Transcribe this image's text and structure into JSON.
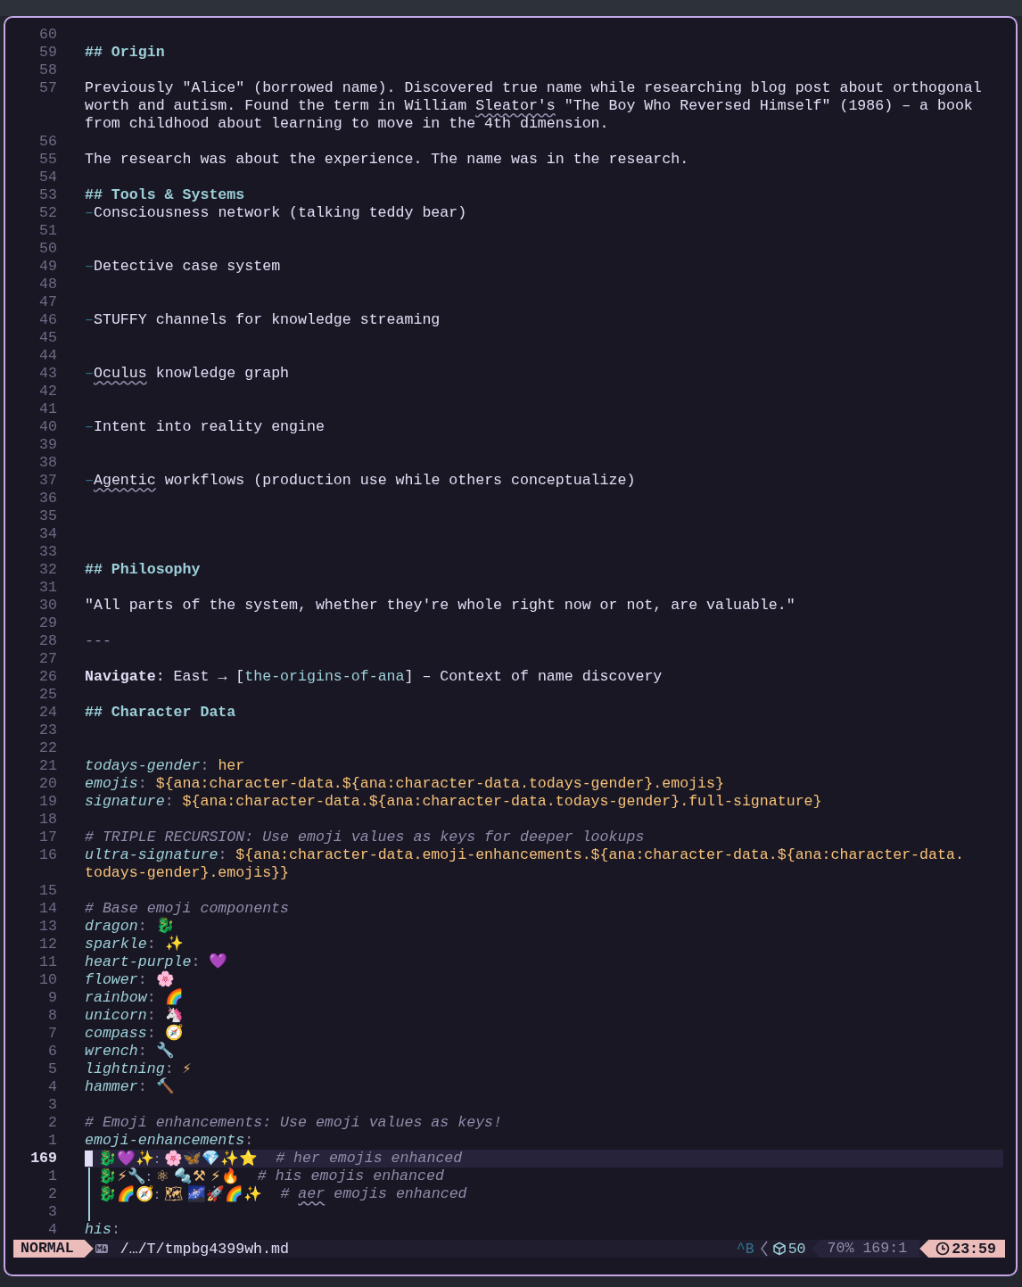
{
  "lines": [
    {
      "number": "60",
      "kind": "blank",
      "current": false
    },
    {
      "number": "59",
      "kind": "heading",
      "current": false,
      "text": "## Origin"
    },
    {
      "number": "58",
      "kind": "blank",
      "current": false
    },
    {
      "number": "57",
      "kind": "prose",
      "current": false,
      "segments": [
        {
          "text": "Previously \"Alice\" (borrowed name). Discovered true name while researching blog post about orthogonal",
          "misspelled": false
        }
      ]
    },
    {
      "kind": "prose",
      "current": false,
      "segments": [
        {
          "text": "worth and autism. Found the term in William ",
          "misspelled": false
        },
        {
          "text": "Sleator's",
          "misspelled": true
        },
        {
          "text": " \"The Boy Who Reversed Himself\" (1986) – a book",
          "misspelled": false
        }
      ]
    },
    {
      "kind": "prose",
      "current": false,
      "segments": [
        {
          "text": "from childhood about learning to move in the 4th dimension.",
          "misspelled": false
        }
      ]
    },
    {
      "number": "56",
      "kind": "blank",
      "current": false
    },
    {
      "number": "55",
      "kind": "prose",
      "current": false,
      "segments": [
        {
          "text": "The research was about the experience. The name was in the research.",
          "misspelled": false
        }
      ]
    },
    {
      "number": "54",
      "kind": "blank",
      "current": false
    },
    {
      "number": "53",
      "kind": "heading",
      "current": false,
      "text": "## Tools & Systems"
    },
    {
      "number": "52",
      "kind": "bullet",
      "current": false,
      "marker": "–",
      "segments": [
        {
          "text": "Consciousness network (talking teddy bear)",
          "misspelled": false
        }
      ]
    },
    {
      "number": "51",
      "kind": "blank",
      "current": false
    },
    {
      "number": "50",
      "kind": "blank",
      "current": false
    },
    {
      "number": "49",
      "kind": "bullet",
      "current": false,
      "marker": "–",
      "segments": [
        {
          "text": "Detective case system",
          "misspelled": false
        }
      ]
    },
    {
      "number": "48",
      "kind": "blank",
      "current": false
    },
    {
      "number": "47",
      "kind": "blank",
      "current": false
    },
    {
      "number": "46",
      "kind": "bullet",
      "current": false,
      "marker": "–",
      "segments": [
        {
          "text": "STUFFY channels for knowledge streaming",
          "misspelled": false
        }
      ]
    },
    {
      "number": "45",
      "kind": "blank",
      "current": false
    },
    {
      "number": "44",
      "kind": "blank",
      "current": false
    },
    {
      "number": "43",
      "kind": "bullet",
      "current": false,
      "marker": "–",
      "segments": [
        {
          "text": "Oculus",
          "misspelled": true
        },
        {
          "text": " knowledge graph",
          "misspelled": false
        }
      ]
    },
    {
      "number": "42",
      "kind": "blank",
      "current": false
    },
    {
      "number": "41",
      "kind": "blank",
      "current": false
    },
    {
      "number": "40",
      "kind": "bullet",
      "current": false,
      "marker": "–",
      "segments": [
        {
          "text": "Intent into reality engine",
          "misspelled": false
        }
      ]
    },
    {
      "number": "39",
      "kind": "blank",
      "current": false
    },
    {
      "number": "38",
      "kind": "blank",
      "current": false
    },
    {
      "number": "37",
      "kind": "bullet",
      "current": false,
      "marker": "–",
      "segments": [
        {
          "text": "Agentic",
          "misspelled": true
        },
        {
          "text": " workflows (production use while others conceptualize)",
          "misspelled": false
        }
      ]
    },
    {
      "number": "36",
      "kind": "blank",
      "current": false
    },
    {
      "number": "35",
      "kind": "blank",
      "current": false
    },
    {
      "number": "34",
      "kind": "blank",
      "current": false
    },
    {
      "number": "33",
      "kind": "blank",
      "current": false
    },
    {
      "number": "32",
      "kind": "heading",
      "current": false,
      "text": "## Philosophy"
    },
    {
      "number": "31",
      "kind": "blank",
      "current": false
    },
    {
      "number": "30",
      "kind": "prose",
      "current": false,
      "segments": [
        {
          "text": "\"All parts of the system, whether they're whole right now or not, are valuable.\"",
          "misspelled": false
        }
      ]
    },
    {
      "number": "29",
      "kind": "blank",
      "current": false
    },
    {
      "number": "28",
      "kind": "rule",
      "current": false,
      "text": "---"
    },
    {
      "number": "27",
      "kind": "blank",
      "current": false
    },
    {
      "number": "26",
      "kind": "nav",
      "current": false,
      "before": "**Navigate**: East → [",
      "link": "the-origins-of-ana",
      "after": "] – Context of name discovery"
    },
    {
      "number": "25",
      "kind": "blank",
      "current": false
    },
    {
      "number": "24",
      "kind": "heading",
      "current": false,
      "text": "## Character Data"
    },
    {
      "number": "23",
      "kind": "blank",
      "current": false
    },
    {
      "number": "22",
      "kind": "blank",
      "current": false
    },
    {
      "number": "21",
      "kind": "pair",
      "current": false,
      "key": "todays-gender",
      "separator": ":",
      "value": "her"
    },
    {
      "number": "20",
      "kind": "pair",
      "current": false,
      "key": "emojis",
      "separator": ":",
      "value": "${ana:character-data.${ana:character-data.todays-gender}.emojis}"
    },
    {
      "number": "19",
      "kind": "pair",
      "current": false,
      "key": "signature",
      "separator": ":",
      "value": "${ana:character-data.${ana:character-data.todays-gender}.full-signature}"
    },
    {
      "number": "18",
      "kind": "blank",
      "current": false
    },
    {
      "number": "17",
      "kind": "comment",
      "current": false,
      "segments": [
        {
          "text": "# TRIPLE RECURSION: Use emoji values as keys for deeper lookups",
          "misspelled": false
        }
      ]
    },
    {
      "number": "16",
      "kind": "pair",
      "current": false,
      "key": "ultra-signature",
      "separator": ":",
      "value": "${ana:character-data.emoji-enhancements.${ana:character-data.${ana:character-data."
    },
    {
      "kind": "continuation",
      "current": false,
      "text": "todays-gender}.emojis}}"
    },
    {
      "number": "15",
      "kind": "blank",
      "current": false
    },
    {
      "number": "14",
      "kind": "comment",
      "current": false,
      "segments": [
        {
          "text": "# Base emoji components",
          "misspelled": false
        }
      ]
    },
    {
      "number": "13",
      "kind": "pair",
      "current": false,
      "key": "dragon",
      "separator": ":",
      "value": "🐉"
    },
    {
      "number": "12",
      "kind": "pair",
      "current": false,
      "key": "sparkle",
      "separator": ":",
      "value": "✨"
    },
    {
      "number": "11",
      "kind": "pair",
      "current": false,
      "key": "heart-purple",
      "separator": ":",
      "value": "💜"
    },
    {
      "number": "10",
      "kind": "pair",
      "current": false,
      "key": "flower",
      "separator": ":",
      "value": "🌸"
    },
    {
      "number": "9",
      "kind": "pair",
      "current": false,
      "key": "rainbow",
      "separator": ":",
      "value": "🌈"
    },
    {
      "number": "8",
      "kind": "pair",
      "current": false,
      "key": "unicorn",
      "separator": ":",
      "value": "🦄"
    },
    {
      "number": "7",
      "kind": "pair",
      "current": false,
      "key": "compass",
      "separator": ":",
      "value": "🧭"
    },
    {
      "number": "6",
      "kind": "pair",
      "current": false,
      "key": "wrench",
      "separator": ":",
      "value": "🔧"
    },
    {
      "number": "5",
      "kind": "pair",
      "current": false,
      "key": "lightning",
      "separator": ":",
      "value": "⚡"
    },
    {
      "number": "4",
      "kind": "pair",
      "current": false,
      "key": "hammer",
      "separator": ":",
      "value": "🔨"
    },
    {
      "number": "3",
      "kind": "blank",
      "current": false
    },
    {
      "number": "2",
      "kind": "comment",
      "current": false,
      "segments": [
        {
          "text": "# Emoji enhancements: Use emoji values as keys!",
          "misspelled": false
        }
      ]
    },
    {
      "number": "1",
      "kind": "pair",
      "current": false,
      "key": "emoji-enhancements",
      "separator": ":"
    },
    {
      "number": "169",
      "kind": "entry",
      "current": true,
      "key": "🐉💜✨",
      "separator": ":",
      "value": "🌸🦋💎✨⭐",
      "segments": [
        {
          "text": "# her emojis enhanced",
          "misspelled": false
        }
      ]
    },
    {
      "number": "1",
      "kind": "entry",
      "current": false,
      "key": "🐉⚡🔧",
      "separator": ":",
      "value": "⚛ 🔩⚒ ⚡🔥",
      "segments": [
        {
          "text": "# his emojis enhanced",
          "misspelled": false
        }
      ]
    },
    {
      "number": "2",
      "kind": "entry",
      "current": false,
      "key": "🐉🌈🧭",
      "separator": ":",
      "value": "🗺 🌌🚀🌈✨",
      "segments": [
        {
          "text": "# ",
          "misspelled": false
        },
        {
          "text": "aer",
          "misspelled": true
        },
        {
          "text": " emojis enhanced",
          "misspelled": false
        }
      ]
    },
    {
      "number": "3",
      "kind": "guide",
      "current": false
    },
    {
      "number": "4",
      "kind": "pair",
      "current": false,
      "key": "his",
      "separator": ":"
    }
  ],
  "status_bar": {
    "mode": "NORMAL",
    "file": "/…/T/tmpbg4399wh.md",
    "keys": "^B",
    "count": "50",
    "position": "70% 169:1",
    "time": "23:59"
  }
}
